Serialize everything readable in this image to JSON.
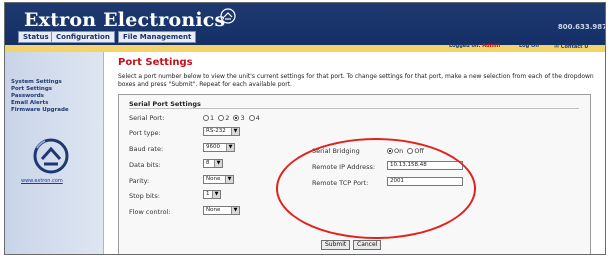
{
  "header": {
    "brand": "Extron Electronics",
    "phone": "800.633.987",
    "tabs": [
      "Status",
      "Configuration",
      "File Management"
    ],
    "logged_on_label": "Logged on:",
    "logged_on_user": "Admin",
    "log_off": "Log Off",
    "contact": "Contact U"
  },
  "sidebar": {
    "items": [
      "System Settings",
      "Port Settings",
      "Passwords",
      "Email Alerts",
      "Firmware Upgrade"
    ],
    "url": "www.extron.com"
  },
  "main": {
    "title": "Port Settings",
    "instructions": "Select a port number below to view the unit's current settings for that port. To change settings for that port, make a new selection from each of the dropdown boxes and press \"Submit\". Repeat for each available port.",
    "panel_title": "Serial Port Settings",
    "serial_port": {
      "label": "Serial Port:",
      "options": [
        "1",
        "2",
        "3",
        "4"
      ],
      "selected": "3"
    },
    "fields": [
      {
        "label": "Port type:",
        "value": "RS-232"
      },
      {
        "label": "Baud rate:",
        "value": "9600"
      },
      {
        "label": "Data bits:",
        "value": "8"
      },
      {
        "label": "Parity:",
        "value": "None"
      },
      {
        "label": "Stop bits:",
        "value": "1"
      },
      {
        "label": "Flow control:",
        "value": "None"
      }
    ],
    "bridging": {
      "label": "Serial Bridging",
      "on_label": "On",
      "off_label": "Off",
      "selected": "On"
    },
    "remote_ip": {
      "label": "Remote IP Address:",
      "value": "10.13.158.48"
    },
    "remote_port": {
      "label": "Remote TCP Port:",
      "value": "2001"
    },
    "submit": "Submit",
    "cancel": "Cancel"
  },
  "colors": {
    "header_blue": "#1d3970",
    "title_red": "#c0141b",
    "highlight_red": "#e0221c",
    "bar_yellow": "#f3d46b"
  }
}
